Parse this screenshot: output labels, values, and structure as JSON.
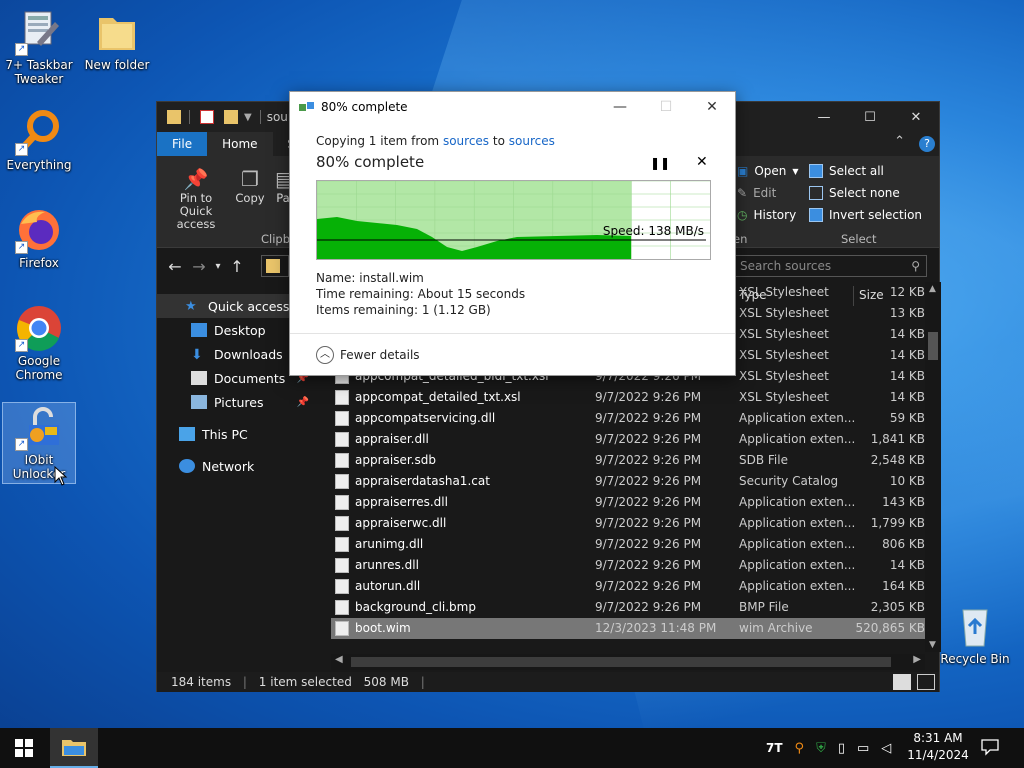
{
  "desktop": {
    "icons": [
      {
        "label": "7+ Taskbar Tweaker"
      },
      {
        "label": "New folder"
      },
      {
        "label": "Everything"
      },
      {
        "label": "Firefox"
      },
      {
        "label": "Google Chrome"
      },
      {
        "label": "IObit Unlocker"
      },
      {
        "label": "Recycle Bin"
      }
    ]
  },
  "explorer": {
    "title_path": "sour",
    "tabs": {
      "file": "File",
      "home": "Home",
      "share": "S"
    },
    "ribbon": {
      "pin_label": "Pin to Quick access",
      "copy_label": "Copy",
      "paste_label": "Pa",
      "clipboard_group": "Clipb",
      "open_label": "Open",
      "edit_label": "Edit",
      "history_label": "History",
      "open_group": "en",
      "select_all": "Select all",
      "select_none": "Select none",
      "invert_selection": "Invert selection",
      "select_group": "Select"
    },
    "search_placeholder": "Search sources",
    "nav": {
      "quick_access": "Quick access",
      "desktop": "Desktop",
      "downloads": "Downloads",
      "documents": "Documents",
      "pictures": "Pictures",
      "this_pc": "This PC",
      "network": "Network"
    },
    "columns": {
      "type": "Type",
      "size": "Size"
    },
    "rows": [
      {
        "name": "",
        "date": "",
        "type": "XSL Stylesheet",
        "size": "12 KB"
      },
      {
        "name": "",
        "date": "",
        "type": "XSL Stylesheet",
        "size": "13 KB"
      },
      {
        "name": "",
        "date": "",
        "type": "XSL Stylesheet",
        "size": "14 KB"
      },
      {
        "name": "",
        "date": "",
        "type": "XSL Stylesheet",
        "size": "14 KB"
      },
      {
        "name": "appcompat_detailed_bidi_txt.xsl",
        "date": "9/7/2022 9:26 PM",
        "type": "XSL Stylesheet",
        "size": "14 KB"
      },
      {
        "name": "appcompat_detailed_txt.xsl",
        "date": "9/7/2022 9:26 PM",
        "type": "XSL Stylesheet",
        "size": "14 KB"
      },
      {
        "name": "appcompatservicing.dll",
        "date": "9/7/2022 9:26 PM",
        "type": "Application exten...",
        "size": "59 KB"
      },
      {
        "name": "appraiser.dll",
        "date": "9/7/2022 9:26 PM",
        "type": "Application exten...",
        "size": "1,841 KB"
      },
      {
        "name": "appraiser.sdb",
        "date": "9/7/2022 9:26 PM",
        "type": "SDB File",
        "size": "2,548 KB"
      },
      {
        "name": "appraiserdatasha1.cat",
        "date": "9/7/2022 9:26 PM",
        "type": "Security Catalog",
        "size": "10 KB"
      },
      {
        "name": "appraiserres.dll",
        "date": "9/7/2022 9:26 PM",
        "type": "Application exten...",
        "size": "143 KB"
      },
      {
        "name": "appraiserwc.dll",
        "date": "9/7/2022 9:26 PM",
        "type": "Application exten...",
        "size": "1,799 KB"
      },
      {
        "name": "arunimg.dll",
        "date": "9/7/2022 9:26 PM",
        "type": "Application exten...",
        "size": "806 KB"
      },
      {
        "name": "arunres.dll",
        "date": "9/7/2022 9:26 PM",
        "type": "Application exten...",
        "size": "14 KB"
      },
      {
        "name": "autorun.dll",
        "date": "9/7/2022 9:26 PM",
        "type": "Application exten...",
        "size": "164 KB"
      },
      {
        "name": "background_cli.bmp",
        "date": "9/7/2022 9:26 PM",
        "type": "BMP File",
        "size": "2,305 KB"
      },
      {
        "name": "boot.wim",
        "date": "12/3/2023 11:48 PM",
        "type": "wim Archive",
        "size": "520,865 KB"
      }
    ],
    "status": {
      "items": "184 items",
      "selected": "1 item selected",
      "size": "508 MB"
    }
  },
  "dialog": {
    "title": "80% complete",
    "copying_prefix": "Copying 1 item from",
    "from": "sources",
    "to_word": "to",
    "to": "sources",
    "heading": "80% complete",
    "progress_fraction": 0.8,
    "speed_text": "Speed: 138 MB/s",
    "name_label": "Name:",
    "name_value": "install.wim",
    "time_label": "Time remaining:",
    "time_value": "About 15 seconds",
    "items_label": "Items remaining:",
    "items_value": "1 (1.12 GB)",
    "fewer_details": "Fewer details",
    "colors": {
      "graph_fill": "#b2e7a6",
      "graph_area": "#06b106"
    }
  },
  "taskbar": {
    "clock_time": "8:31 AM",
    "clock_date": "11/4/2024"
  }
}
